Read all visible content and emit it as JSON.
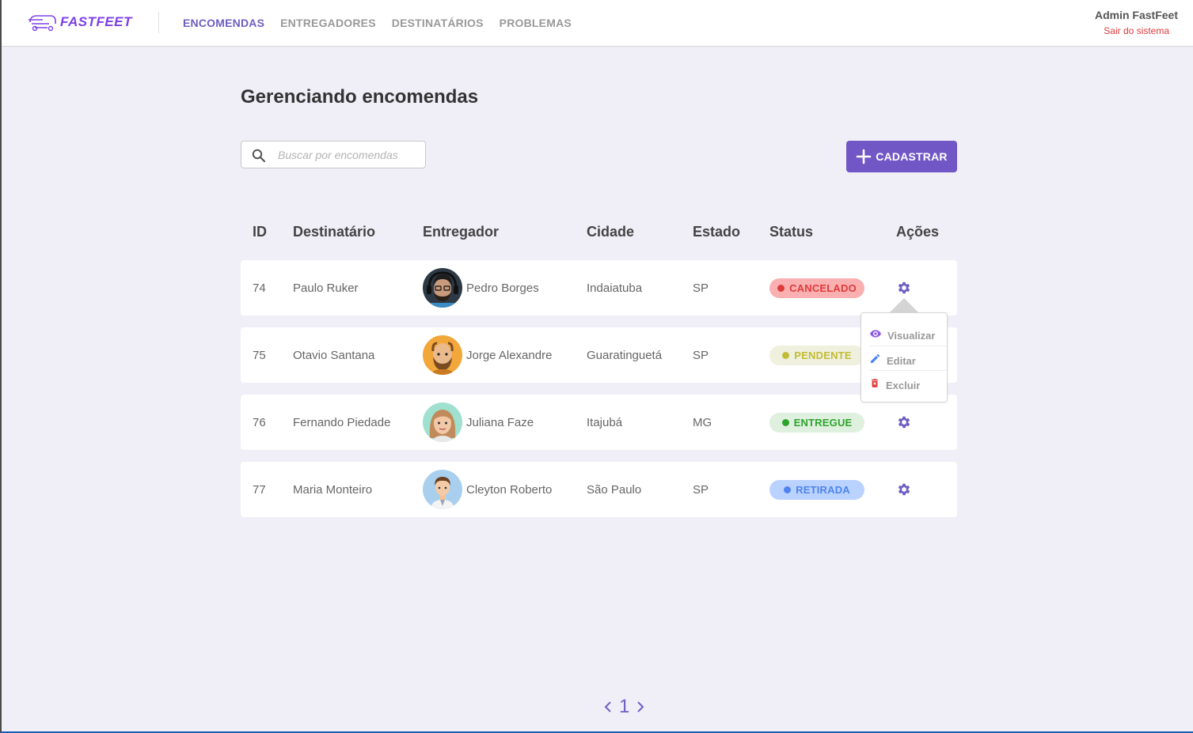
{
  "app": {
    "name": "FASTFEET",
    "brand_color": "#7d40e7",
    "accent": "#7156c6"
  },
  "nav": {
    "items": [
      "ENCOMENDAS",
      "ENTREGADORES",
      "DESTINATÁRIOS",
      "PROBLEMAS"
    ],
    "active": "ENCOMENDAS"
  },
  "user": {
    "name": "Admin FastFeet",
    "logout": "Sair do sistema"
  },
  "page": {
    "title": "Gerenciando encomendas"
  },
  "search": {
    "placeholder": "Buscar por encomendas",
    "value": ""
  },
  "actions": {
    "register_label": "CADASTRAR"
  },
  "table": {
    "headers": [
      "ID",
      "Destinatário",
      "Entregador",
      "Cidade",
      "Estado",
      "Status",
      "Ações"
    ],
    "rows": [
      {
        "id": "74",
        "recipient": "Paulo Ruker",
        "courier": "Pedro Borges",
        "avatar": "avatar-man-headphones",
        "city": "Indaiatuba",
        "state": "SP",
        "status": "CANCELADO"
      },
      {
        "id": "75",
        "recipient": "Otavio Santana",
        "courier": "Jorge Alexandre",
        "avatar": "avatar-man-bald-beard",
        "city": "Guaratinguetá",
        "state": "SP",
        "status": "PENDENTE"
      },
      {
        "id": "76",
        "recipient": "Fernando Piedade",
        "courier": "Juliana Faze",
        "avatar": "avatar-woman",
        "city": "Itajubá",
        "state": "MG",
        "status": "ENTREGUE"
      },
      {
        "id": "77",
        "recipient": "Maria Monteiro",
        "courier": "Cleyton Roberto",
        "avatar": "avatar-man-shirt",
        "city": "São Paulo",
        "state": "SP",
        "status": "RETIRADA"
      }
    ]
  },
  "status_colors": {
    "CANCELADO": {
      "bg": "#fab0b0",
      "dot": "#de3b3b",
      "text": "#de3b3b"
    },
    "PENDENTE": {
      "bg": "#f0f0df",
      "dot": "#c1bc35",
      "text": "#c1bc35"
    },
    "ENTREGUE": {
      "bg": "#dff0df",
      "dot": "#2ca42b",
      "text": "#2ca42b"
    },
    "RETIRADA": {
      "bg": "#bad2ff",
      "dot": "#4d85ee",
      "text": "#4d85ee"
    }
  },
  "row_menu": {
    "items": [
      "Visualizar",
      "Editar",
      "Excluir"
    ],
    "icons": [
      "eye-icon",
      "pencil-icon",
      "trash-icon"
    ]
  },
  "pagination": {
    "current": "1"
  }
}
